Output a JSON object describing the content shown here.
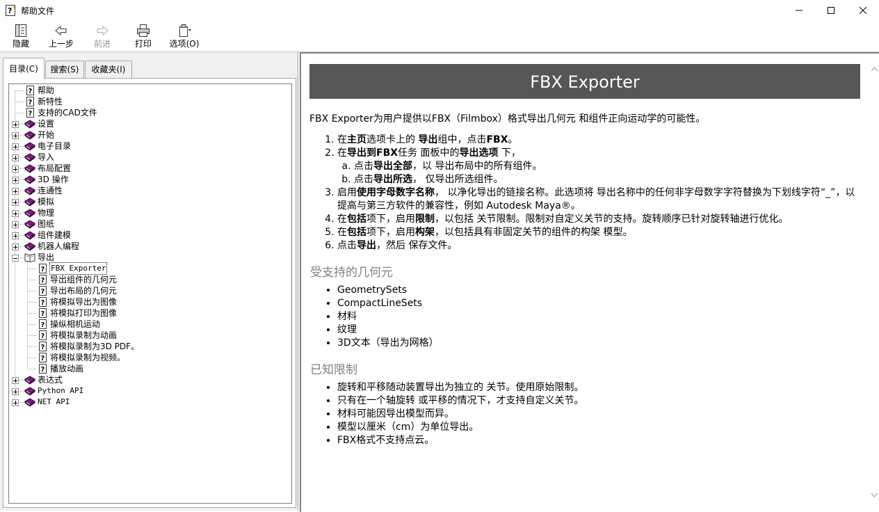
{
  "window": {
    "title": "帮助文件",
    "controls": [
      "minimize-icon",
      "maximize-icon",
      "close-icon"
    ]
  },
  "toolbar": {
    "hide": "隐藏",
    "back": "上一步",
    "forward": "前进",
    "print": "打印",
    "options": "选项(O)"
  },
  "tabs": {
    "contents": "目录(C)",
    "search": "搜索(S)",
    "favorites": "收藏夹(I)"
  },
  "tree": [
    {
      "label": "帮助",
      "type": "page",
      "level": 0
    },
    {
      "label": "新特性",
      "type": "page",
      "level": 0
    },
    {
      "label": "支持的CAD文件",
      "type": "page",
      "level": 0
    },
    {
      "label": "设置",
      "type": "book",
      "level": 0
    },
    {
      "label": "开始",
      "type": "book",
      "level": 0
    },
    {
      "label": "电子目录",
      "type": "book",
      "level": 0
    },
    {
      "label": "导入",
      "type": "book",
      "level": 0
    },
    {
      "label": "布局配置",
      "type": "book",
      "level": 0
    },
    {
      "label": "3D 操作",
      "type": "book",
      "level": 0
    },
    {
      "label": "连通性",
      "type": "book",
      "level": 0
    },
    {
      "label": "模拟",
      "type": "book",
      "level": 0
    },
    {
      "label": "物理",
      "type": "book",
      "level": 0
    },
    {
      "label": "图纸",
      "type": "book",
      "level": 0
    },
    {
      "label": "组件建模",
      "type": "book",
      "level": 0
    },
    {
      "label": "机器人编程",
      "type": "book",
      "level": 0
    },
    {
      "label": "导出",
      "type": "open-book",
      "level": 0
    },
    {
      "label": "FBX Exporter",
      "type": "page",
      "level": 1,
      "selected": true,
      "mono": true
    },
    {
      "label": "导出组件的几何元",
      "type": "page",
      "level": 1
    },
    {
      "label": "导出布局的几何元",
      "type": "page",
      "level": 1
    },
    {
      "label": "将模拟导出为图像",
      "type": "page",
      "level": 1
    },
    {
      "label": "将模拟打印为图像",
      "type": "page",
      "level": 1
    },
    {
      "label": "操纵相机运动",
      "type": "page",
      "level": 1
    },
    {
      "label": "将模拟录制为动画",
      "type": "page",
      "level": 1
    },
    {
      "label": "将模拟录制为3D PDF。",
      "type": "page",
      "level": 1
    },
    {
      "label": "将模拟录制为视频。",
      "type": "page",
      "level": 1
    },
    {
      "label": "播放动画",
      "type": "page",
      "level": 1
    },
    {
      "label": "表达式",
      "type": "book",
      "level": 0
    },
    {
      "label": "Python API",
      "type": "book",
      "level": 0,
      "mono": true
    },
    {
      "label": "NET API",
      "type": "book",
      "level": 0,
      "mono": true
    }
  ],
  "article": {
    "title": "FBX Exporter",
    "intro": "FBX Exporter为用户提供以FBX（Filmbox）格式导出几何元 和组件正向运动学的可能性。",
    "steps": {
      "s1": {
        "a": "在",
        "b": "主页",
        "c": "选项卡上的 ",
        "d": "导出",
        "e": "组中，点击",
        "f": "FBX",
        "g": "。"
      },
      "s2": {
        "a": "在",
        "b": "导出到FBX",
        "c": "任务 面板中的",
        "d": "导出选项",
        "e": " 下，"
      },
      "s2a": {
        "a": "点击",
        "b": "导出全部",
        "c": "，以 导出布局中的所有组件。"
      },
      "s2b": {
        "a": "点击",
        "b": "导出所选",
        "c": "，  仅导出所选组件。"
      },
      "s3": {
        "a": "启用",
        "b": "使用字母数字名称",
        "c": "，  以净化导出的链接名称。此选项将 导出名称中的任何非字母数字字符替换为下划线字符“_”，以提高与第三方软件的兼容性，例如 Autodesk Maya®。"
      },
      "s4": {
        "a": "在",
        "b": "包括",
        "c": "项下，启用",
        "d": "限制",
        "e": "，以包括 关节限制。限制对自定义关节的支持。旋转顺序已针对旋转轴进行优化。"
      },
      "s5": {
        "a": "在",
        "b": "包括",
        "c": "项下，启用",
        "d": "构架",
        "e": "，以包括具有非固定关节的组件的构架 模型。"
      },
      "s6": {
        "a": "点击",
        "b": "导出",
        "c": "，然后 保存文件。"
      }
    },
    "supported_heading": "受支持的几何元",
    "supported": [
      "GeometrySets",
      "CompactLineSets",
      "材料",
      "纹理",
      "3D文本（导出为网格）"
    ],
    "limits_heading": "已知限制",
    "limits": [
      "旋转和平移随动装置导出为独立的 关节。使用原始限制。",
      "只有在一个轴旋转 或平移的情况下，才支持自定义关节。",
      "材料可能因导出模型而异。",
      "模型以厘米（cm）为单位导出。",
      "FBX格式不支持点云。"
    ]
  }
}
